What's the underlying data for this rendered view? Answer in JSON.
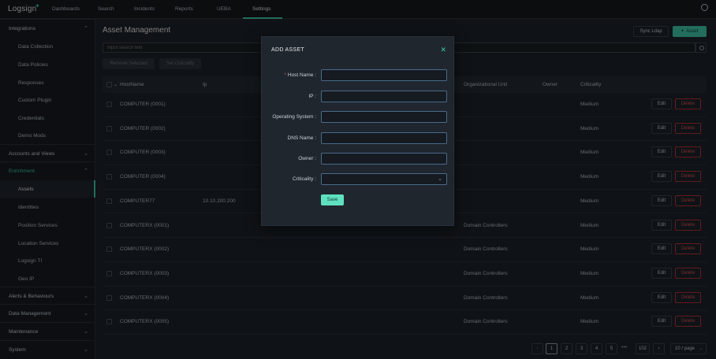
{
  "app": {
    "logo": "Logsign",
    "settings_icon": "gear-icon"
  },
  "nav": {
    "items": [
      "Dashboards",
      "Search",
      "Incidents",
      "Reports",
      "UEBA",
      "Settings"
    ],
    "active": "Settings"
  },
  "sidebar": {
    "items": [
      {
        "label": "Integrations",
        "type": "section",
        "chevron": "up"
      },
      {
        "label": "Data Collection",
        "type": "sub"
      },
      {
        "label": "Data Policies",
        "type": "sub"
      },
      {
        "label": "Responses",
        "type": "sub"
      },
      {
        "label": "Custom Plugin",
        "type": "sub"
      },
      {
        "label": "Credentials",
        "type": "sub"
      },
      {
        "label": "Demo Mods",
        "type": "sub"
      },
      {
        "label": "Accounts and Views",
        "type": "section",
        "chevron": "down"
      },
      {
        "label": "Enrichment",
        "type": "section-active",
        "chevron": "up"
      },
      {
        "label": "Assets",
        "type": "sub-selected"
      },
      {
        "label": "Identities",
        "type": "sub"
      },
      {
        "label": "Position Services",
        "type": "sub"
      },
      {
        "label": "Location Services",
        "type": "sub"
      },
      {
        "label": "Logsign TI",
        "type": "sub"
      },
      {
        "label": "Geo IP",
        "type": "sub"
      },
      {
        "label": "Alerts & Behaviours",
        "type": "section",
        "chevron": "down"
      },
      {
        "label": "Data Management",
        "type": "section",
        "chevron": "down"
      },
      {
        "label": "Maintenance",
        "type": "section",
        "chevron": "down"
      },
      {
        "label": "System",
        "type": "section",
        "chevron": "down"
      }
    ]
  },
  "main": {
    "title": "Asset Management",
    "sync_label": "Sync Ldap",
    "add_label": "Asset",
    "search_placeholder": "Input search text",
    "remove_selected": "Remove Selected",
    "set_criticality": "Set Criticality"
  },
  "table": {
    "headers": [
      "HostName",
      "Ip",
      "Organizational Unit",
      "Owner",
      "Criticality"
    ],
    "edit_label": "Edit",
    "delete_label": "Delete",
    "rows": [
      {
        "host": "COMPUTER (0001)",
        "ip": "",
        "ou": "",
        "owner": "",
        "crit": "Medium"
      },
      {
        "host": "COMPUTER (0002)",
        "ip": "",
        "ou": "",
        "owner": "",
        "crit": "Medium"
      },
      {
        "host": "COMPUTER (0003)",
        "ip": "",
        "ou": "",
        "owner": "",
        "crit": "Medium"
      },
      {
        "host": "COMPUTER (0004)",
        "ip": "",
        "ou": "",
        "owner": "",
        "crit": "Medium"
      },
      {
        "host": "COMPUTER77",
        "ip": "10.10.200.200",
        "ou": "",
        "owner": "",
        "crit": "Medium"
      },
      {
        "host": "COMPUTERX (0001)",
        "ip": "",
        "ou": "Domain Controllers",
        "owner": "",
        "crit": "Medium"
      },
      {
        "host": "COMPUTERX (0002)",
        "ip": "",
        "ou": "Domain Controllers",
        "owner": "",
        "crit": "Medium"
      },
      {
        "host": "COMPUTERX (0003)",
        "ip": "",
        "ou": "Domain Controllers",
        "owner": "",
        "crit": "Medium"
      },
      {
        "host": "COMPUTERX (0004)",
        "ip": "",
        "ou": "Domain Controllers",
        "owner": "",
        "crit": "Medium"
      },
      {
        "host": "COMPUTERX (0005)",
        "ip": "",
        "ou": "Domain Controllers",
        "owner": "",
        "crit": "Medium"
      }
    ]
  },
  "pagination": {
    "prev": "‹",
    "pages": [
      "1",
      "2",
      "3",
      "4",
      "5"
    ],
    "ellipsis": "•••",
    "last": "102",
    "next": "›",
    "current": "1",
    "page_size": "10 / page"
  },
  "modal": {
    "title": "ADD ASSET",
    "close_icon": "close-icon",
    "fields": [
      {
        "label": "Host Name",
        "required": true,
        "value": ""
      },
      {
        "label": "IP",
        "required": false,
        "value": ""
      },
      {
        "label": "Operating System",
        "required": false,
        "value": ""
      },
      {
        "label": "DNS Name",
        "required": false,
        "value": ""
      },
      {
        "label": "Owner",
        "required": false,
        "value": ""
      },
      {
        "label": "Criticality",
        "required": false,
        "value": "",
        "type": "select"
      }
    ],
    "save_label": "Save"
  },
  "colors": {
    "accent": "#3ec6a8",
    "danger": "#d9534f",
    "bg": "#1c2128",
    "sidebar": "#161b21"
  }
}
